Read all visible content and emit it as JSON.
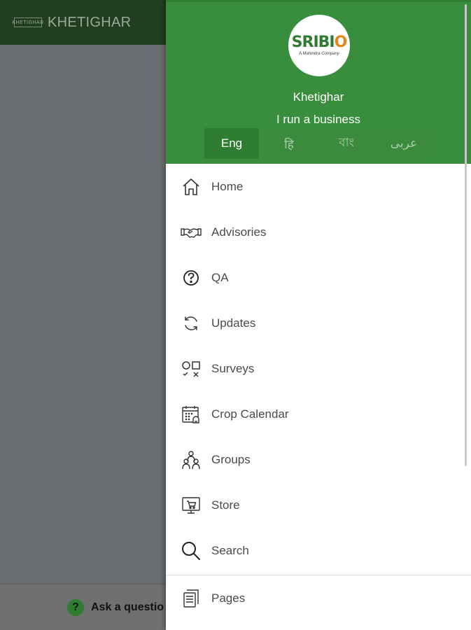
{
  "app": {
    "title": "KHETIGHAR",
    "logo_text": "KHETIGHAR",
    "bottom_ask": "Ask a questio"
  },
  "drawer": {
    "avatar": {
      "brand_prefix": "SRIBI",
      "brand_o": "O",
      "tagline": "A Mahindra Company"
    },
    "profile": {
      "name": "Khetighar",
      "role": "I run a business"
    },
    "languages": [
      {
        "label": "Eng",
        "active": true
      },
      {
        "label": "हि",
        "active": false
      },
      {
        "label": "বাং",
        "active": false
      },
      {
        "label": "عربى",
        "active": false
      }
    ],
    "menu": [
      {
        "label": "Home",
        "icon": "home-icon"
      },
      {
        "label": "Advisories",
        "icon": "handshake-icon"
      },
      {
        "label": "QA",
        "icon": "question-circle-icon"
      },
      {
        "label": "Updates",
        "icon": "refresh-icon"
      },
      {
        "label": "Surveys",
        "icon": "survey-icon"
      },
      {
        "label": "Crop Calendar",
        "icon": "calendar-icon"
      },
      {
        "label": "Groups",
        "icon": "groups-icon"
      },
      {
        "label": "Store",
        "icon": "store-icon"
      },
      {
        "label": "Search",
        "icon": "search-icon"
      }
    ],
    "menu_secondary": [
      {
        "label": "Pages",
        "icon": "pages-icon"
      }
    ]
  },
  "colors": {
    "header_green": "#388e3c",
    "app_bar_dim": "#1f3f1f",
    "overlay_gray": "#6a6d70"
  }
}
